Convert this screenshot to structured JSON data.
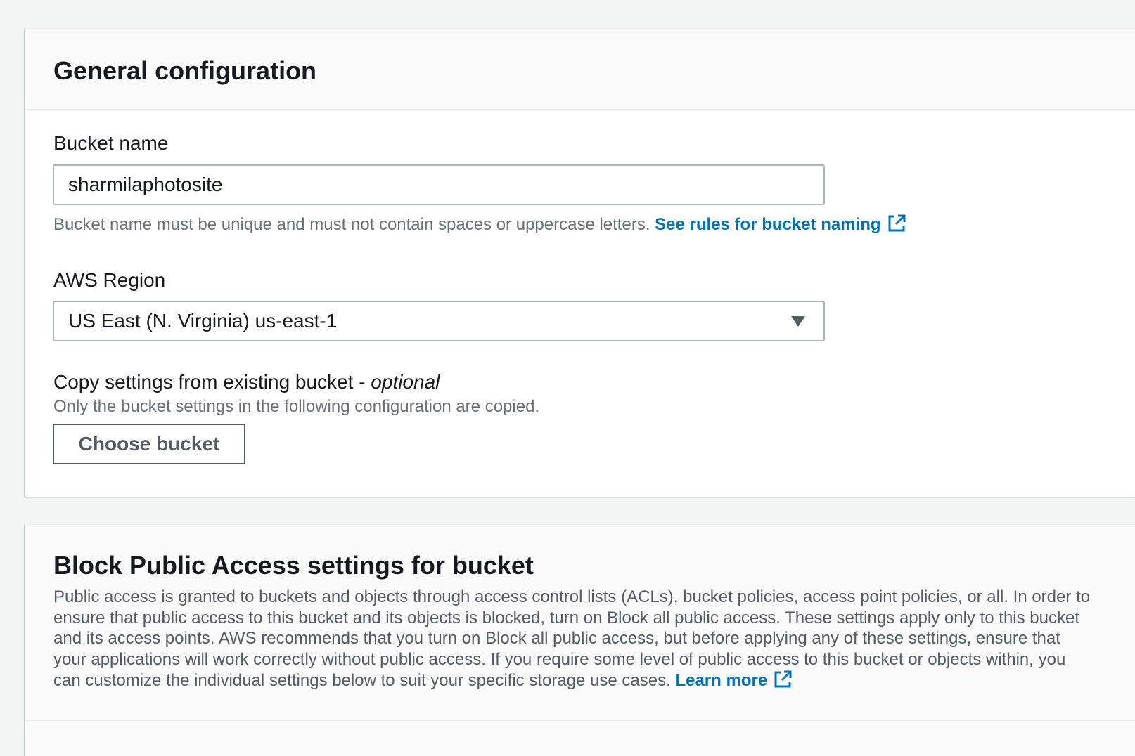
{
  "general": {
    "title": "General configuration",
    "bucket_name_label": "Bucket name",
    "bucket_name_value": "sharmilaphotosite",
    "bucket_name_hint": "Bucket name must be unique and must not contain spaces or uppercase letters.",
    "bucket_name_link": "See rules for bucket naming",
    "region_label": "AWS Region",
    "region_value": "US East (N. Virginia) us-east-1",
    "copy_label": "Copy settings from existing bucket - ",
    "copy_label_optional": "optional",
    "copy_hint": "Only the bucket settings in the following configuration are copied.",
    "choose_bucket_label": "Choose bucket"
  },
  "block_public_access": {
    "title": "Block Public Access settings for bucket",
    "description": "Public access is granted to buckets and objects through access control lists (ACLs), bucket policies, access point policies, or all. In order to ensure that public access to this bucket and its objects is blocked, turn on Block all public access. These settings apply only to this bucket and its access points. AWS recommends that you turn on Block all public access, but before applying any of these settings, ensure that your applications will work correctly without public access. If you require some level of public access to this bucket or objects within, you can customize the individual settings below to suit your specific storage use cases.",
    "learn_more_link": "Learn more"
  },
  "icons": {
    "external_link": "external-link-icon",
    "dropdown": "caret-down-icon"
  },
  "colors": {
    "link": "#0073bb",
    "text": "#16191f",
    "muted": "#687078",
    "border": "#aab7b8",
    "button_border": "#545b64"
  }
}
